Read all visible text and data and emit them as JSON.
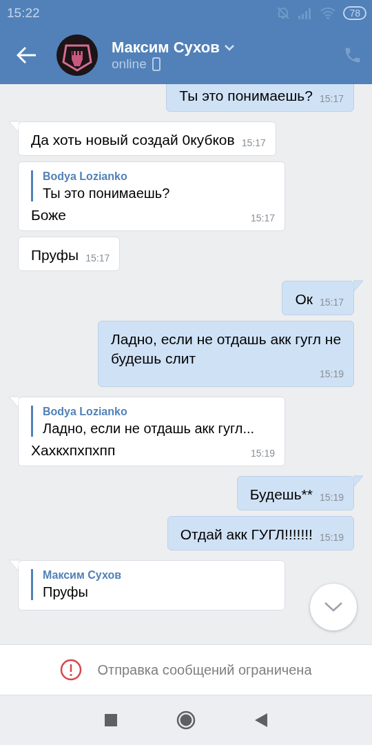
{
  "status_bar": {
    "time": "15:22",
    "battery": "78"
  },
  "header": {
    "name": "Максим Сухов",
    "status": "online"
  },
  "messages": [
    {
      "kind": "outgoing",
      "tail": false,
      "text": "Ты это понимаешь?",
      "time": "15:17"
    },
    {
      "kind": "incoming",
      "tail": true,
      "text": "Да хоть новый создай 0кубков",
      "time": "15:17"
    },
    {
      "kind": "incoming",
      "tail": false,
      "reply": {
        "author": "Bodya Lozianko",
        "text": "Ты это понимаешь?"
      },
      "text": "Боже",
      "time": "15:17"
    },
    {
      "kind": "incoming",
      "tail": false,
      "text": "Пруфы",
      "time": "15:17"
    },
    {
      "kind": "outgoing",
      "tail": true,
      "text": "Ок",
      "time": "15:17"
    },
    {
      "kind": "outgoing",
      "tail": false,
      "text": "Ладно, если не отдашь акк гугл не будешь слит",
      "time": "15:19"
    },
    {
      "kind": "incoming",
      "tail": true,
      "reply": {
        "author": "Bodya Lozianko",
        "text": "Ладно, если не отдашь акк гугл..."
      },
      "text": "Хахкхпхпхпп",
      "time": "15:19"
    },
    {
      "kind": "outgoing",
      "tail": true,
      "text": "Будешь**",
      "time": "15:19"
    },
    {
      "kind": "outgoing",
      "tail": false,
      "text": "Отдай акк ГУГЛ!!!!!!!",
      "time": "15:19"
    },
    {
      "kind": "incoming",
      "tail": true,
      "reply": {
        "author": "Максим Сухов",
        "text": "Пруфы"
      }
    }
  ],
  "notice": "Отправка сообщений ограничена"
}
